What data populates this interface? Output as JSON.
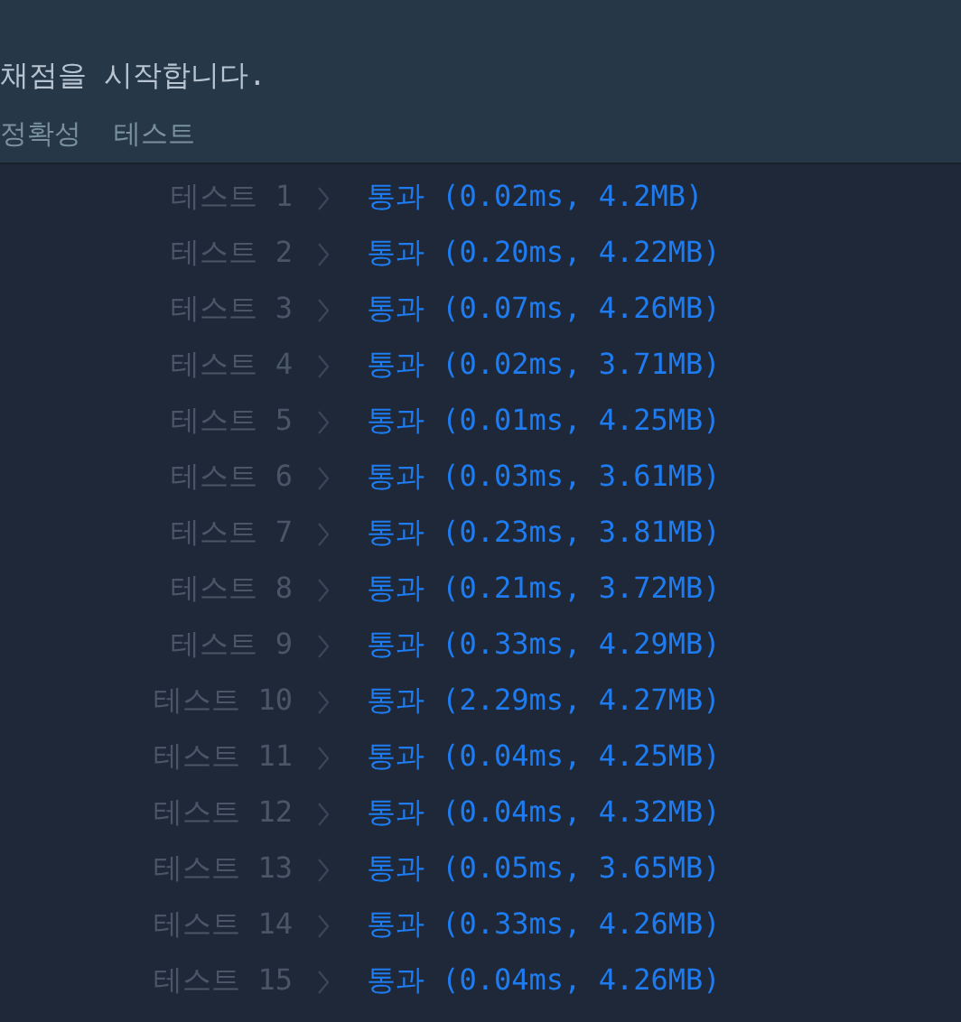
{
  "console": {
    "message": "채점을 시작합니다.",
    "section_title": [
      "정확성",
      "테스트"
    ]
  },
  "results": [
    {
      "label": "테스트 1",
      "result": "통과 (0.02ms, 4.2MB)"
    },
    {
      "label": "테스트 2",
      "result": "통과 (0.20ms, 4.22MB)"
    },
    {
      "label": "테스트 3",
      "result": "통과 (0.07ms, 4.26MB)"
    },
    {
      "label": "테스트 4",
      "result": "통과 (0.02ms, 3.71MB)"
    },
    {
      "label": "테스트 5",
      "result": "통과 (0.01ms, 4.25MB)"
    },
    {
      "label": "테스트 6",
      "result": "통과 (0.03ms, 3.61MB)"
    },
    {
      "label": "테스트 7",
      "result": "통과 (0.23ms, 3.81MB)"
    },
    {
      "label": "테스트 8",
      "result": "통과 (0.21ms, 3.72MB)"
    },
    {
      "label": "테스트 9",
      "result": "통과 (0.33ms, 4.29MB)"
    },
    {
      "label": "테스트 10",
      "result": "통과 (2.29ms, 4.27MB)"
    },
    {
      "label": "테스트 11",
      "result": "통과 (0.04ms, 4.25MB)"
    },
    {
      "label": "테스트 12",
      "result": "통과 (0.04ms, 4.32MB)"
    },
    {
      "label": "테스트 13",
      "result": "통과 (0.05ms, 3.65MB)"
    },
    {
      "label": "테스트 14",
      "result": "통과 (0.33ms, 4.26MB)"
    },
    {
      "label": "테스트 15",
      "result": "통과 (0.04ms, 4.26MB)"
    }
  ]
}
